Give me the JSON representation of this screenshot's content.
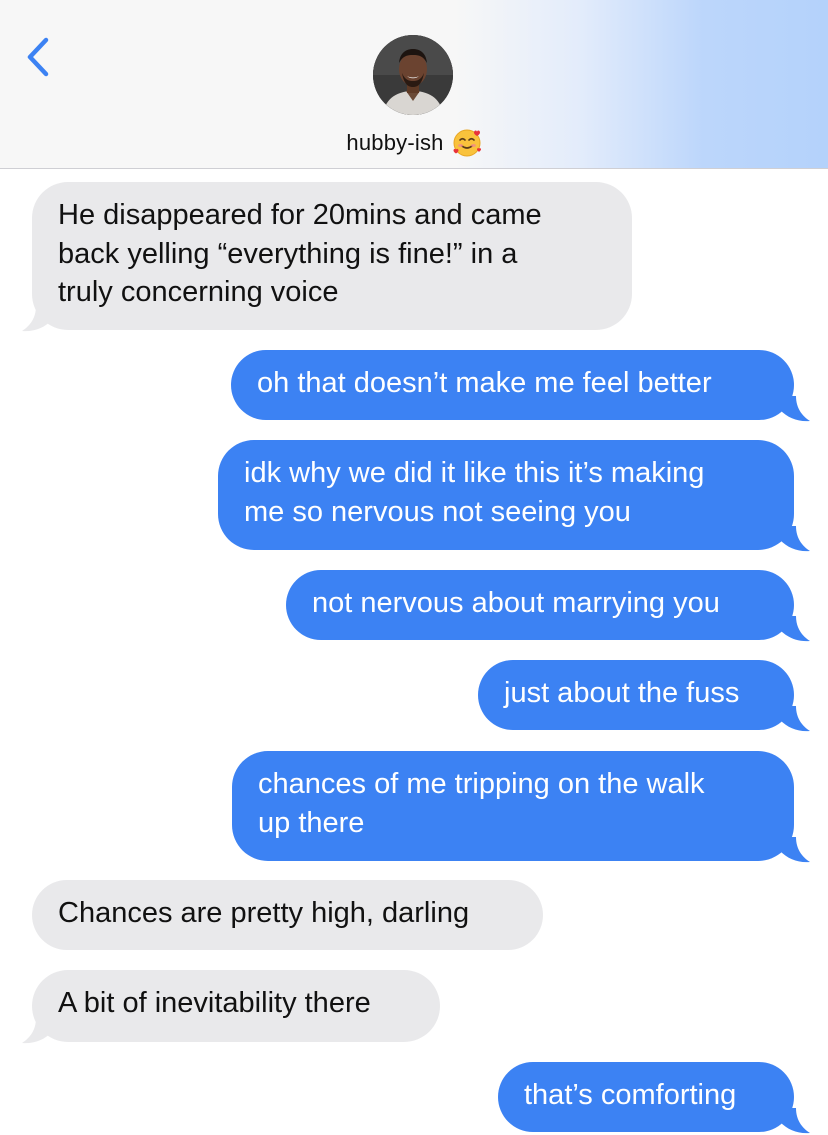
{
  "header": {
    "back_icon": "chevron-left-icon",
    "contact_name": "hubby-ish",
    "contact_emoji": "smiling-face-with-hearts-emoji",
    "accent_color": "#3c82f3"
  },
  "messages": [
    {
      "direction": "incoming",
      "lines": [
        "He disappeared for 20mins and came",
        "back yelling “everything is fine!” in a",
        "truly concerning voice"
      ]
    },
    {
      "direction": "outgoing",
      "lines": [
        "oh that doesn’t make me feel better"
      ]
    },
    {
      "direction": "outgoing",
      "lines": [
        "idk why we did it like this it’s making",
        "me so nervous not seeing you"
      ]
    },
    {
      "direction": "outgoing",
      "lines": [
        "not nervous about marrying you"
      ]
    },
    {
      "direction": "outgoing",
      "lines": [
        "just about the fuss"
      ]
    },
    {
      "direction": "outgoing",
      "lines": [
        "chances of me tripping on the walk",
        "up there"
      ]
    },
    {
      "direction": "incoming",
      "lines": [
        "Chances are pretty high, darling"
      ]
    },
    {
      "direction": "incoming",
      "lines": [
        "A bit of inevitability there"
      ]
    },
    {
      "direction": "outgoing",
      "lines": [
        "that’s comforting"
      ]
    }
  ],
  "colors": {
    "incoming_bubble": "#e9e9eb",
    "outgoing_bubble": "#3c82f3",
    "incoming_text": "#111111",
    "outgoing_text": "#ffffff"
  }
}
